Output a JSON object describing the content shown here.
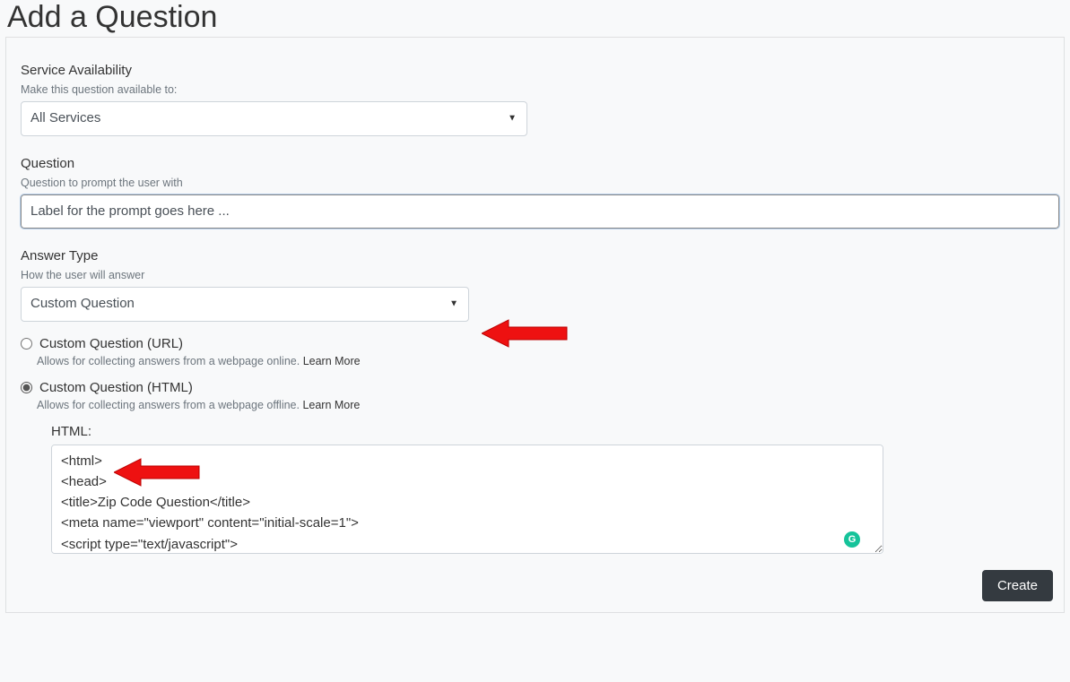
{
  "title": "Add a Question",
  "sections": {
    "service": {
      "heading": "Service Availability",
      "help": "Make this question available to:",
      "selected": "All Services"
    },
    "question": {
      "heading": "Question",
      "help": "Question to prompt the user with",
      "value": "Label for the prompt goes here ...",
      "placeholder": ""
    },
    "answer_type": {
      "heading": "Answer Type",
      "help": "How the user will answer",
      "selected": "Custom Question"
    },
    "custom_url": {
      "label": "Custom Question (URL)",
      "help": "Allows for collecting answers from a webpage online.",
      "learn_more": "Learn More"
    },
    "custom_html": {
      "label": "Custom Question (HTML)",
      "help": "Allows for collecting answers from a webpage offline.",
      "learn_more": "Learn More",
      "html_label": "HTML:",
      "html_value": "<html>\n<head>\n<title>Zip Code Question</title>\n<meta name=\"viewport\" content=\"initial-scale=1\">\n<script type=\"text/javascript\">"
    }
  },
  "custom_mode": "html",
  "buttons": {
    "create": "Create"
  },
  "badges": {
    "grammarly": "G"
  }
}
